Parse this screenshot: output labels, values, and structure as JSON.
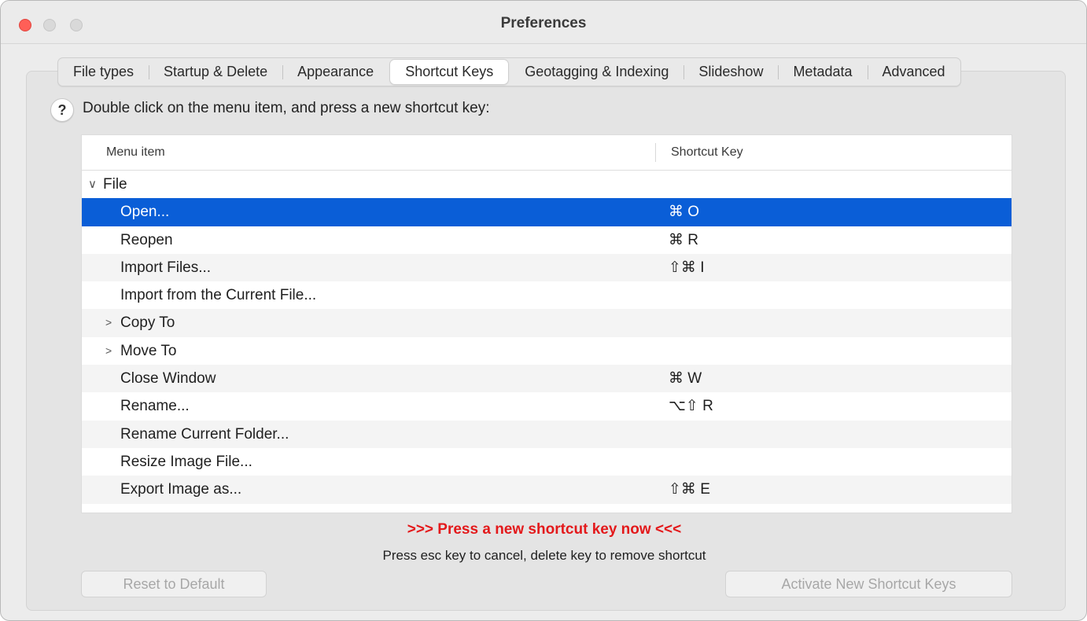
{
  "window": {
    "title": "Preferences"
  },
  "tabs": [
    {
      "label": "File types",
      "active": false
    },
    {
      "label": "Startup & Delete",
      "active": false
    },
    {
      "label": "Appearance",
      "active": false
    },
    {
      "label": "Shortcut Keys",
      "active": true
    },
    {
      "label": "Geotagging & Indexing",
      "active": false
    },
    {
      "label": "Slideshow",
      "active": false
    },
    {
      "label": "Metadata",
      "active": false
    },
    {
      "label": "Advanced",
      "active": false
    }
  ],
  "help": {
    "icon": "?",
    "instruction": "Double click on the menu item, and press a new shortcut key:"
  },
  "table": {
    "headers": {
      "menu_item": "Menu item",
      "shortcut_key": "Shortcut Key"
    },
    "rows": [
      {
        "label": "File",
        "key": "",
        "kind": "group",
        "chevron": "∨"
      },
      {
        "label": "Open...",
        "key": "⌘ O",
        "kind": "item",
        "selected": true
      },
      {
        "label": "Reopen",
        "key": "⌘ R",
        "kind": "item"
      },
      {
        "label": "Import Files...",
        "key": "⇧⌘ I",
        "kind": "item"
      },
      {
        "label": "Import from the Current File...",
        "key": "",
        "kind": "item"
      },
      {
        "label": "Copy To",
        "key": "",
        "kind": "child-group",
        "chevron": ">"
      },
      {
        "label": "Move To",
        "key": "",
        "kind": "child-group",
        "chevron": ">"
      },
      {
        "label": "Close Window",
        "key": "⌘ W",
        "kind": "item"
      },
      {
        "label": "Rename...",
        "key": "⌥⇧ R",
        "kind": "item"
      },
      {
        "label": "Rename Current Folder...",
        "key": "",
        "kind": "item"
      },
      {
        "label": "Resize Image File...",
        "key": "",
        "kind": "item"
      },
      {
        "label": "Export Image as...",
        "key": "⇧⌘ E",
        "kind": "item"
      }
    ]
  },
  "messages": {
    "press": ">>> Press a new shortcut key now <<<",
    "cancel": "Press esc key to cancel, delete key to remove shortcut"
  },
  "buttons": {
    "reset": "Reset to Default",
    "activate": "Activate New Shortcut Keys"
  },
  "colors": {
    "selection": "#0a5ed7",
    "alert": "#e3191b",
    "close_button": "#ff5f57"
  }
}
